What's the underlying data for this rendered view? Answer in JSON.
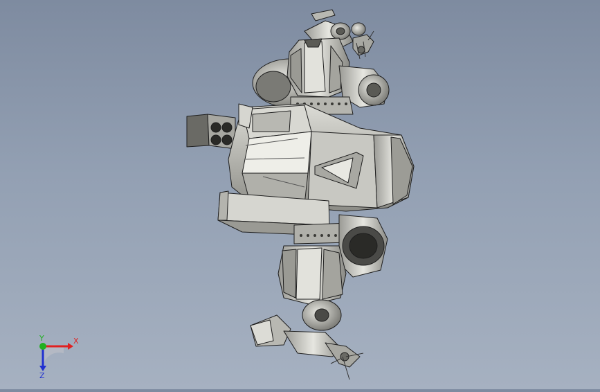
{
  "viewport": {
    "background_top": "#7e8ba0",
    "background_bottom": "#a6b1c1",
    "model_fill": "#c9c9c4",
    "model_shade": "#8f8f8a",
    "model_dark": "#4a4a47",
    "model_light": "#e4e4df",
    "edge_color": "#1e1e1e"
  },
  "triad": {
    "x_label": "X",
    "y_label": "Y",
    "z_label": "Z",
    "x_color": "#e02020",
    "y_color": "#20b020",
    "z_color": "#2030d0"
  }
}
